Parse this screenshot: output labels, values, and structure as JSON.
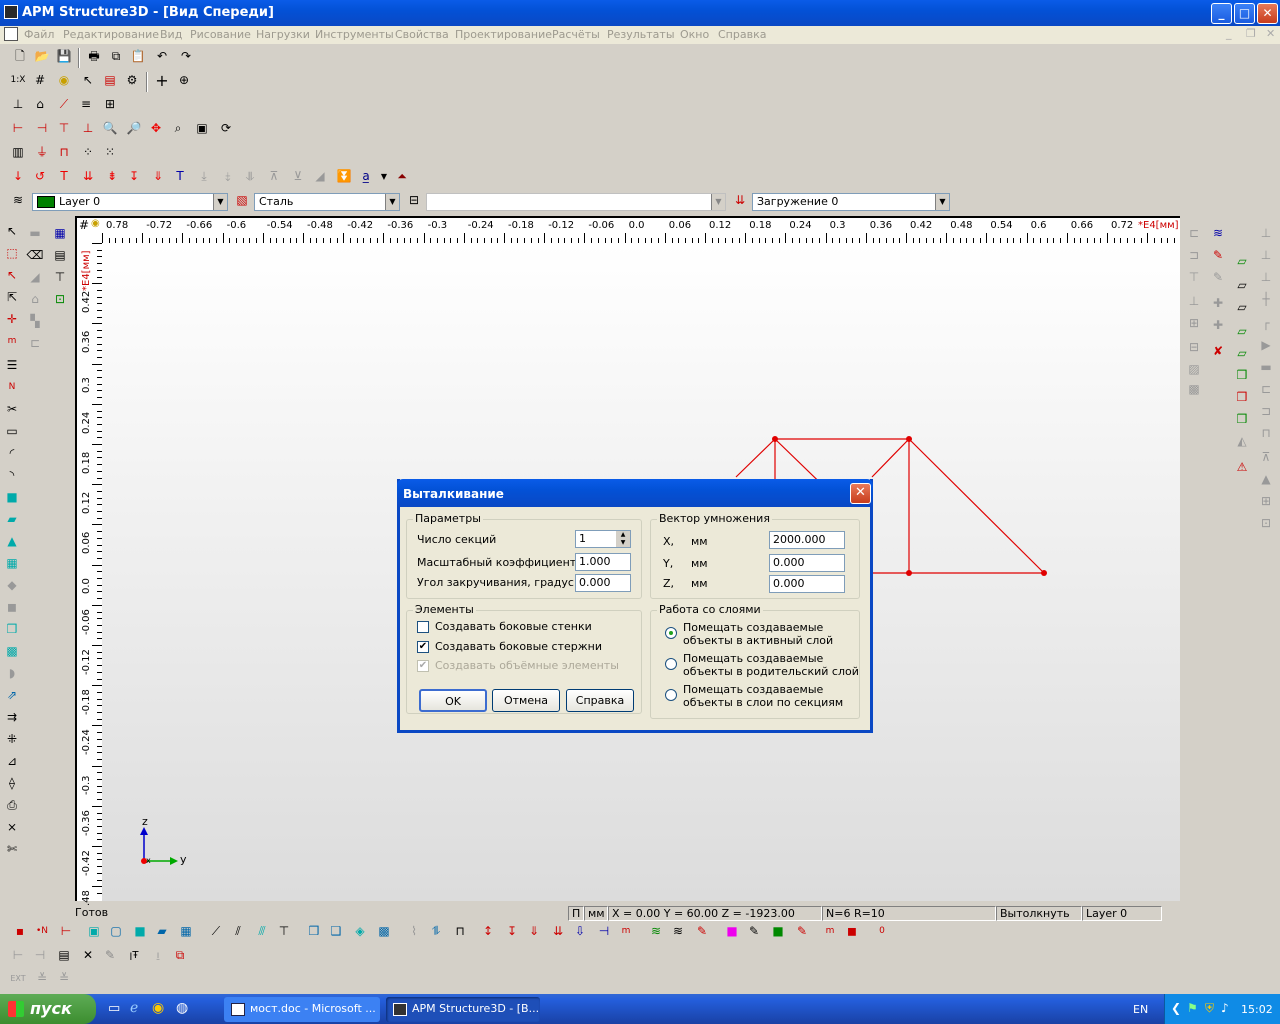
{
  "window": {
    "title": "APM Structure3D - [Вид Спереди]"
  },
  "menu": [
    "Файл",
    "Редактирование",
    "Вид",
    "Рисование",
    "Нагрузки",
    "Инструменты",
    "Свойства",
    "Проектирование",
    "Расчёты",
    "Результаты",
    "Окно",
    "Справка"
  ],
  "combos": {
    "layer": "Layer 0",
    "material": "Сталь",
    "extra": "",
    "load": "Загружение 0"
  },
  "ruler": {
    "h_labels": [
      "0.78",
      "-0.72",
      "-0.66",
      "-0.6",
      "-0.54",
      "-0.48",
      "-0.42",
      "-0.36",
      "-0.3",
      "-0.24",
      "-0.18",
      "-0.12",
      "-0.06",
      "0.0",
      "0.06",
      "0.12",
      "0.18",
      "0.24",
      "0.3",
      "0.36",
      "0.42",
      "0.48",
      "0.54",
      "0.6",
      "0.66",
      "0.72"
    ],
    "h_unit": "*E4[мм]",
    "v_labels": [
      "0.42",
      "0.36",
      "0.3",
      "0.24",
      "0.18",
      "0.12",
      "0.06",
      "0.0",
      "-0.06",
      "-0.12",
      "-0.18",
      "-0.24",
      "-0.3",
      "-0.36",
      "-0.42",
      "-0.48"
    ],
    "v_unit": "*E4[мм]"
  },
  "axes": {
    "z": "z",
    "y": "y"
  },
  "dialog": {
    "title": "Выталкивание",
    "params": {
      "group": "Параметры",
      "sections_label": "Число секций",
      "sections": "1",
      "scale_label": "Масштабный коэффициент",
      "scale": "1.000",
      "twist_label": "Угол закручивания, градус",
      "twist": "0.000"
    },
    "vector": {
      "group": "Вектор умножения",
      "x_label": "X,",
      "y_label": "Y,",
      "z_label": "Z,",
      "unit": "мм",
      "x": "2000.000",
      "y": "0.000",
      "z": "0.000"
    },
    "elements": {
      "group": "Элементы",
      "side_walls": "Создавать боковые стенки",
      "side_walls_checked": false,
      "side_rods": "Создавать боковые стержни",
      "side_rods_checked": true,
      "volume": "Создавать объёмные элементы",
      "volume_checked": true
    },
    "layers": {
      "group": "Работа со слоями",
      "opt1a": "Помещать создаваемые",
      "opt1b": "объекты в активный слой",
      "opt2a": "Помещать создаваемые",
      "opt2b": "объекты в родительский слой",
      "opt3a": "Помещать создаваемые",
      "opt3b": "объекты в слои по секциям",
      "selected": 1
    },
    "ok": "OK",
    "cancel": "Отмена",
    "help": "Справка"
  },
  "status": {
    "ready": "Готов",
    "p": "П",
    "mm": "мм",
    "coords": "X = 0.00 Y = 60.00 Z = -1923.00",
    "nr": "N=6 R=10",
    "cmd": "Вытолкнуть",
    "layer": "Layer 0"
  },
  "taskbar": {
    "start": "пуск",
    "task1": "мост.doc - Microsoft ...",
    "task2": "APM Structure3D - [В...",
    "lang": "EN",
    "clock": "15:02"
  },
  "colors": {
    "accent": "#0a48c4",
    "model": "#e00000"
  }
}
